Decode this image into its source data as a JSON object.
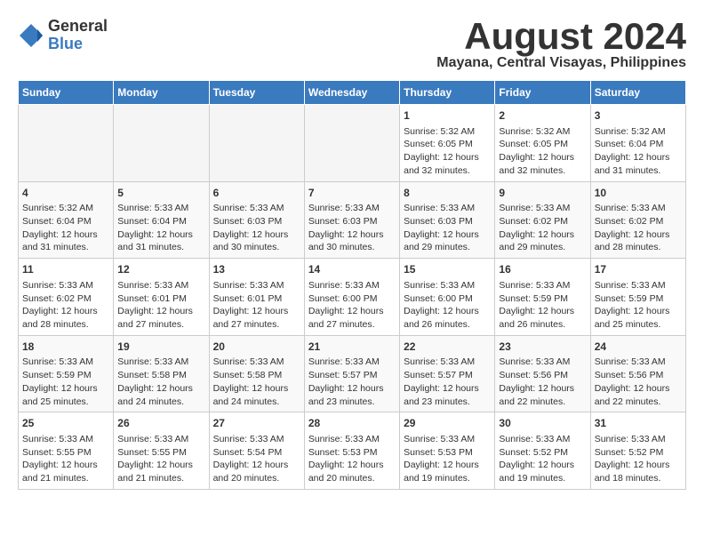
{
  "header": {
    "logo_general": "General",
    "logo_blue": "Blue",
    "month_title": "August 2024",
    "location": "Mayana, Central Visayas, Philippines"
  },
  "days_of_week": [
    "Sunday",
    "Monday",
    "Tuesday",
    "Wednesday",
    "Thursday",
    "Friday",
    "Saturday"
  ],
  "weeks": [
    {
      "days": [
        {
          "number": "",
          "content": ""
        },
        {
          "number": "",
          "content": ""
        },
        {
          "number": "",
          "content": ""
        },
        {
          "number": "",
          "content": ""
        },
        {
          "number": "1",
          "content": "Sunrise: 5:32 AM\nSunset: 6:05 PM\nDaylight: 12 hours\nand 32 minutes."
        },
        {
          "number": "2",
          "content": "Sunrise: 5:32 AM\nSunset: 6:05 PM\nDaylight: 12 hours\nand 32 minutes."
        },
        {
          "number": "3",
          "content": "Sunrise: 5:32 AM\nSunset: 6:04 PM\nDaylight: 12 hours\nand 31 minutes."
        }
      ]
    },
    {
      "days": [
        {
          "number": "4",
          "content": "Sunrise: 5:32 AM\nSunset: 6:04 PM\nDaylight: 12 hours\nand 31 minutes."
        },
        {
          "number": "5",
          "content": "Sunrise: 5:33 AM\nSunset: 6:04 PM\nDaylight: 12 hours\nand 31 minutes."
        },
        {
          "number": "6",
          "content": "Sunrise: 5:33 AM\nSunset: 6:03 PM\nDaylight: 12 hours\nand 30 minutes."
        },
        {
          "number": "7",
          "content": "Sunrise: 5:33 AM\nSunset: 6:03 PM\nDaylight: 12 hours\nand 30 minutes."
        },
        {
          "number": "8",
          "content": "Sunrise: 5:33 AM\nSunset: 6:03 PM\nDaylight: 12 hours\nand 29 minutes."
        },
        {
          "number": "9",
          "content": "Sunrise: 5:33 AM\nSunset: 6:02 PM\nDaylight: 12 hours\nand 29 minutes."
        },
        {
          "number": "10",
          "content": "Sunrise: 5:33 AM\nSunset: 6:02 PM\nDaylight: 12 hours\nand 28 minutes."
        }
      ]
    },
    {
      "days": [
        {
          "number": "11",
          "content": "Sunrise: 5:33 AM\nSunset: 6:02 PM\nDaylight: 12 hours\nand 28 minutes."
        },
        {
          "number": "12",
          "content": "Sunrise: 5:33 AM\nSunset: 6:01 PM\nDaylight: 12 hours\nand 27 minutes."
        },
        {
          "number": "13",
          "content": "Sunrise: 5:33 AM\nSunset: 6:01 PM\nDaylight: 12 hours\nand 27 minutes."
        },
        {
          "number": "14",
          "content": "Sunrise: 5:33 AM\nSunset: 6:00 PM\nDaylight: 12 hours\nand 27 minutes."
        },
        {
          "number": "15",
          "content": "Sunrise: 5:33 AM\nSunset: 6:00 PM\nDaylight: 12 hours\nand 26 minutes."
        },
        {
          "number": "16",
          "content": "Sunrise: 5:33 AM\nSunset: 5:59 PM\nDaylight: 12 hours\nand 26 minutes."
        },
        {
          "number": "17",
          "content": "Sunrise: 5:33 AM\nSunset: 5:59 PM\nDaylight: 12 hours\nand 25 minutes."
        }
      ]
    },
    {
      "days": [
        {
          "number": "18",
          "content": "Sunrise: 5:33 AM\nSunset: 5:59 PM\nDaylight: 12 hours\nand 25 minutes."
        },
        {
          "number": "19",
          "content": "Sunrise: 5:33 AM\nSunset: 5:58 PM\nDaylight: 12 hours\nand 24 minutes."
        },
        {
          "number": "20",
          "content": "Sunrise: 5:33 AM\nSunset: 5:58 PM\nDaylight: 12 hours\nand 24 minutes."
        },
        {
          "number": "21",
          "content": "Sunrise: 5:33 AM\nSunset: 5:57 PM\nDaylight: 12 hours\nand 23 minutes."
        },
        {
          "number": "22",
          "content": "Sunrise: 5:33 AM\nSunset: 5:57 PM\nDaylight: 12 hours\nand 23 minutes."
        },
        {
          "number": "23",
          "content": "Sunrise: 5:33 AM\nSunset: 5:56 PM\nDaylight: 12 hours\nand 22 minutes."
        },
        {
          "number": "24",
          "content": "Sunrise: 5:33 AM\nSunset: 5:56 PM\nDaylight: 12 hours\nand 22 minutes."
        }
      ]
    },
    {
      "days": [
        {
          "number": "25",
          "content": "Sunrise: 5:33 AM\nSunset: 5:55 PM\nDaylight: 12 hours\nand 21 minutes."
        },
        {
          "number": "26",
          "content": "Sunrise: 5:33 AM\nSunset: 5:55 PM\nDaylight: 12 hours\nand 21 minutes."
        },
        {
          "number": "27",
          "content": "Sunrise: 5:33 AM\nSunset: 5:54 PM\nDaylight: 12 hours\nand 20 minutes."
        },
        {
          "number": "28",
          "content": "Sunrise: 5:33 AM\nSunset: 5:53 PM\nDaylight: 12 hours\nand 20 minutes."
        },
        {
          "number": "29",
          "content": "Sunrise: 5:33 AM\nSunset: 5:53 PM\nDaylight: 12 hours\nand 19 minutes."
        },
        {
          "number": "30",
          "content": "Sunrise: 5:33 AM\nSunset: 5:52 PM\nDaylight: 12 hours\nand 19 minutes."
        },
        {
          "number": "31",
          "content": "Sunrise: 5:33 AM\nSunset: 5:52 PM\nDaylight: 12 hours\nand 18 minutes."
        }
      ]
    }
  ]
}
